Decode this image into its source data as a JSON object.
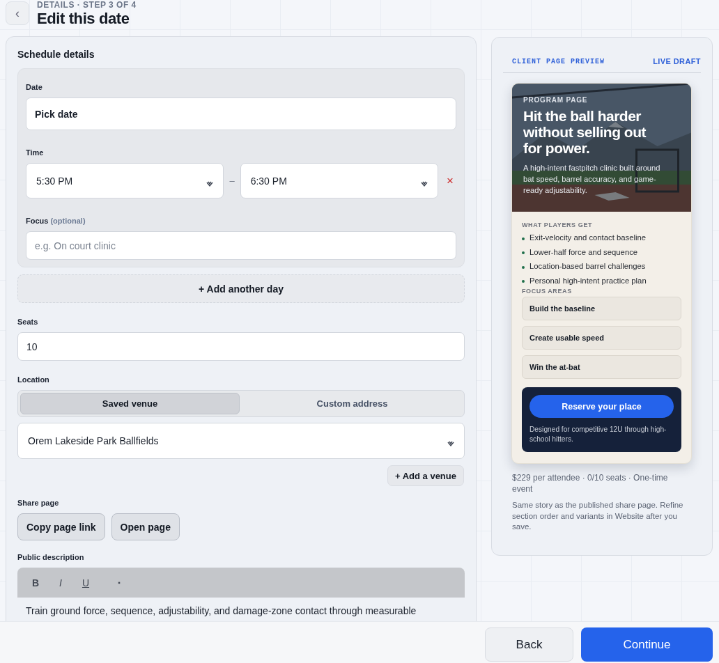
{
  "header": {
    "back": "‹",
    "step": "DETAILS · STEP 3 OF 4",
    "title": "Edit this date"
  },
  "schedule": {
    "heading": "Schedule details",
    "day": {
      "date_label": "Date",
      "date_value": "Pick date",
      "time_label": "Time",
      "start_time": "5:30 PM",
      "separator": "–",
      "end_time": "6:30 PM",
      "remove": "×",
      "focus_label": "Focus",
      "focus_hint": "(optional)",
      "focus_placeholder": "e.g. On court clinic"
    },
    "add_day": "+ Add another day",
    "seats_label": "Seats",
    "seats_value": "10",
    "location_label": "Location",
    "location_tabs": [
      {
        "label": "Saved venue",
        "selected": true
      },
      {
        "label": "Custom address",
        "selected": false
      }
    ],
    "venue": "Orem Lakeside Park Ballfields",
    "add_venue": "+ Add a venue",
    "share_label": "Share page",
    "share_buttons": [
      "Copy page link",
      "Open page"
    ],
    "description_label": "Public description",
    "toolbar": [
      {
        "label": "B",
        "kind": "bold"
      },
      {
        "label": "I",
        "kind": "italic"
      },
      {
        "label": "U",
        "kind": "underline"
      },
      {
        "label": "▪",
        "kind": "bullet"
      }
    ],
    "description": "Train ground force, sequence, adjustability, and damage-zone contact through measurable"
  },
  "preview": {
    "label": "CLIENT PAGE PREVIEW",
    "status": "LIVE DRAFT",
    "hero": {
      "kind": "picture",
      "eyebrow": "PROGRAM PAGE",
      "title": "Hit the ball harder without selling out for power.",
      "subtitle": "A high-intent fastpitch clinic built around bat speed, barrel accuracy, and game-ready adjustability."
    },
    "benefits_heading": "WHAT PLAYERS GET",
    "benefits": [
      "Exit-velocity and contact baseline",
      "Lower-half force and sequence",
      "Location-based barrel challenges",
      "Personal high-intent practice plan"
    ],
    "focus_heading": "FOCUS AREAS",
    "focus_areas": [
      "Build the baseline",
      "Create usable speed",
      "Win the at-bat"
    ],
    "cta": "Reserve your place",
    "cta_note": "Designed for competitive 12U through high-school hitters.",
    "meta": "$229 per attendee · 0/10 seats · One-time event",
    "note": "Same story as the published share page. Refine section order and variants in Website after you save."
  },
  "footer": {
    "buttons": [
      {
        "label": "Back",
        "kind": "secondary"
      },
      {
        "label": "Continue",
        "kind": "primary"
      }
    ]
  }
}
